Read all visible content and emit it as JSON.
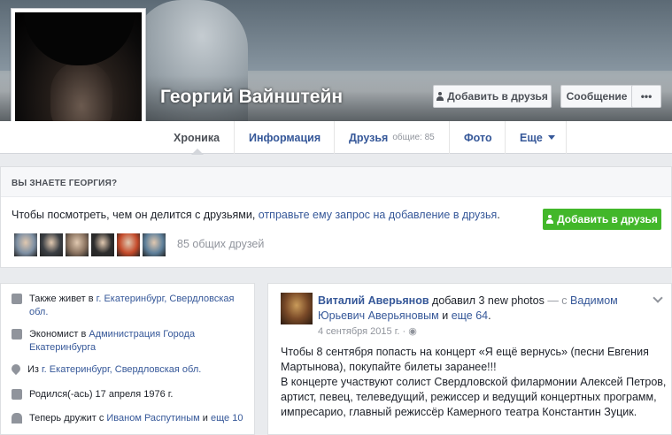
{
  "profile": {
    "name": "Георгий Вайнштейн",
    "add_friend_label": "Добавить в друзья",
    "message_label": "Сообщение",
    "more_label": "•••"
  },
  "nav": {
    "tabs": [
      {
        "label": "Хроника"
      },
      {
        "label": "Информация"
      },
      {
        "label": "Друзья",
        "count": "общие: 85"
      },
      {
        "label": "Фото"
      },
      {
        "label": "Еще"
      }
    ]
  },
  "know": {
    "header": "ВЫ ЗНАЕТЕ ГЕОРГИЯ?",
    "text_prefix": "Чтобы посмотреть, чем он делится с друзьями, ",
    "text_link": "отправьте ему запрос на добавление в друзья",
    "text_suffix": ".",
    "button_label": "Добавить в друзья",
    "mutual_count": "85 общих друзей",
    "mutual_colors": [
      "#7d8fa3",
      "#3b3f44",
      "#8a7360",
      "#2d2d2d",
      "#c44a2a",
      "#5d7f9a"
    ]
  },
  "intro": {
    "items": [
      {
        "prefix": "Также живет в ",
        "link": "г. Екатеринбург, Свердловская обл.",
        "icon": "home-icon"
      },
      {
        "prefix": "Экономист в ",
        "link": "Администрация Города Екатеринбурга",
        "icon": "briefcase-icon"
      },
      {
        "prefix": "Из ",
        "link": "г. Екатеринбург, Свердловская обл.",
        "icon": "location-pin-icon"
      },
      {
        "prefix": "Родился(-ась) 17 апреля 1976 г.",
        "link": "",
        "icon": "calendar-icon"
      },
      {
        "prefix": "Теперь дружит с ",
        "link": "Иваном Распутиным",
        "middle": " и ",
        "link2": "еще 10",
        "icon": "friends-icon"
      }
    ]
  },
  "post": {
    "author": "Виталий Аверьянов",
    "action": " добавил 3 new photos",
    "dash": " — с ",
    "with": "Вадимом Юрьевич Аверьяновым",
    "and": " и ",
    "others": "еще 64",
    "dot": ".",
    "date": "4 сентября 2015 г. · ",
    "globe": "◉",
    "body_1": "Чтобы 8 сентября попасть на концерт «Я ещё вернусь» (песни Евгения Мартынова), покупайте билеты заранее!!!",
    "body_2": "В концерте участвуют солист Свердловской филармонии Алексей Петров, артист, певец, телеведущий, режиссер и ведущий концертных программ, импресарио, главный режиссёр Камерного театра Константин Зуцик."
  }
}
